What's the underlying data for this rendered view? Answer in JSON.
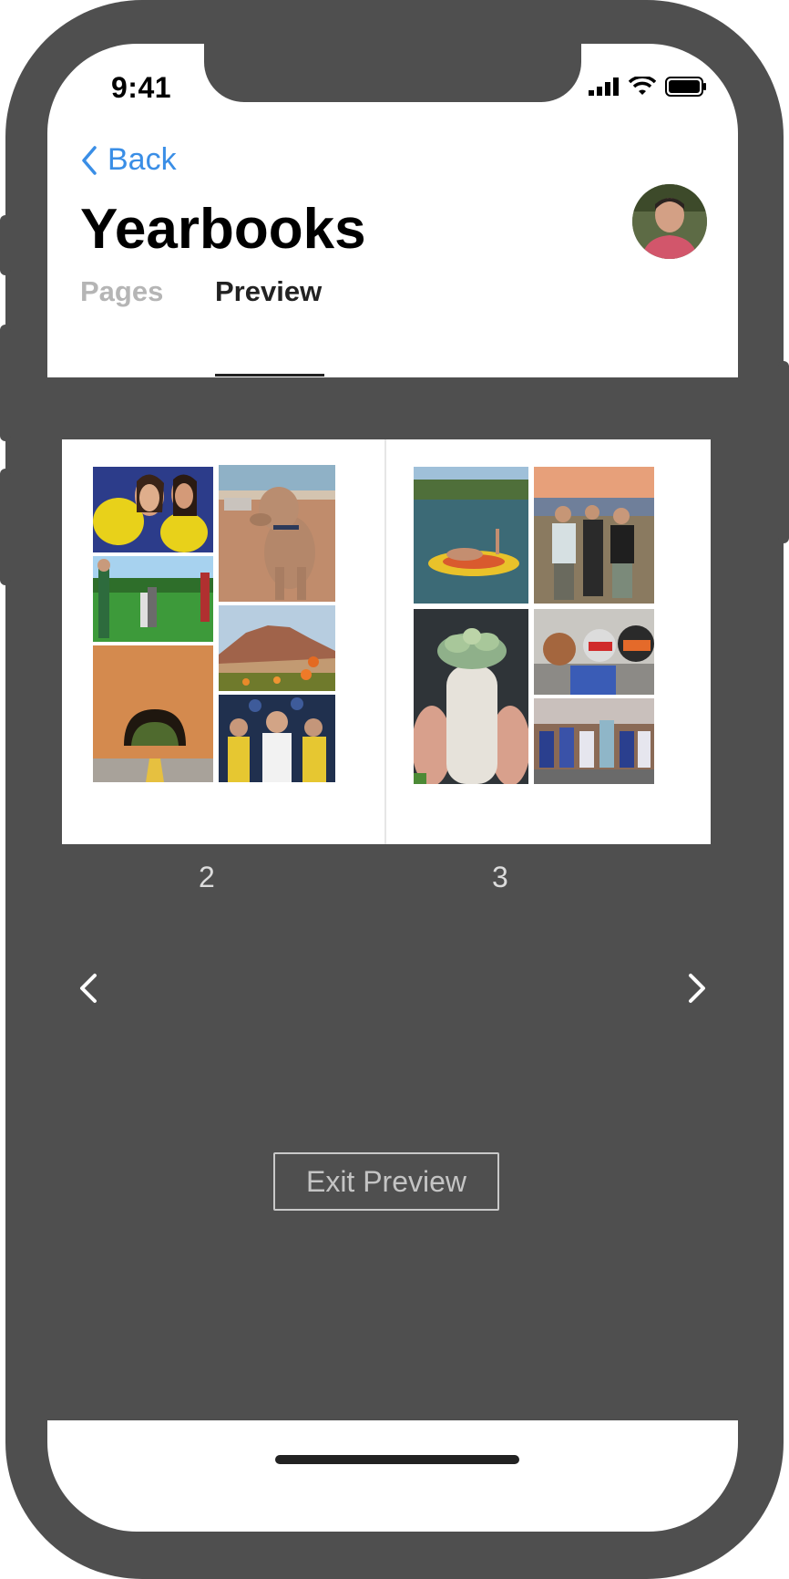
{
  "status_bar": {
    "time": "9:41"
  },
  "header": {
    "back_label": "Back",
    "title": "Yearbooks"
  },
  "tabs": [
    {
      "label": "Pages",
      "active": false
    },
    {
      "label": "Preview",
      "active": true
    }
  ],
  "spread": {
    "left_page": {
      "number": "2",
      "photos": [
        "paw-sign-friends",
        "dog-on-beach",
        "golf-green",
        "mountain-wildflowers",
        "rock-tunnel-road",
        "basketball-crowd"
      ]
    },
    "right_page": {
      "number": "3",
      "photos": [
        "lake-float",
        "sunset-friends",
        "succulent-pot",
        "ski-selfie",
        "cheerleaders"
      ]
    }
  },
  "controls": {
    "prev_icon": "chevron-left-icon",
    "next_icon": "chevron-right-icon",
    "exit_label": "Exit Preview"
  },
  "colors": {
    "accent": "#3a8ee6",
    "frame": "#4f4f4f",
    "background": "#ffffff"
  }
}
